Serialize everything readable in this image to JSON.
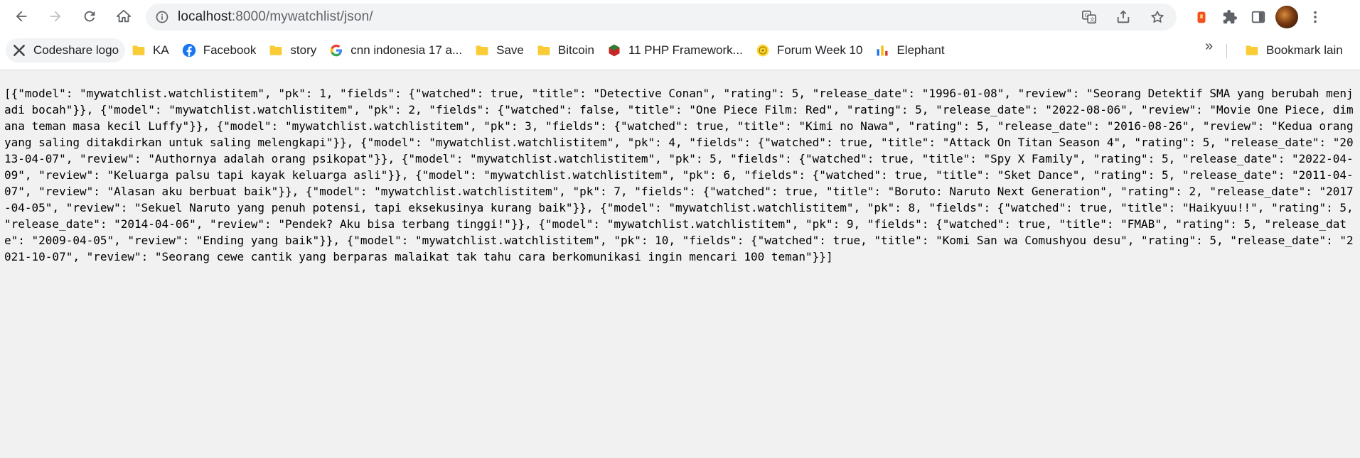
{
  "browser": {
    "url_prefix": "localhost",
    "url_rest": ":8000/mywatchlist/json/"
  },
  "bookmarks": [
    {
      "label": "Codeshare logo",
      "icon": "codeshare-icon"
    },
    {
      "label": "KA",
      "icon": "folder-icon"
    },
    {
      "label": "Facebook",
      "icon": "facebook-icon"
    },
    {
      "label": "story",
      "icon": "folder-icon"
    },
    {
      "label": "cnn indonesia 17 a...",
      "icon": "google-icon"
    },
    {
      "label": "Save",
      "icon": "folder-icon"
    },
    {
      "label": "Bitcoin",
      "icon": "folder-icon"
    },
    {
      "label": "11 PHP Framework...",
      "icon": "site-icon"
    },
    {
      "label": "Forum Week 10",
      "icon": "forum-icon"
    },
    {
      "label": "Elephant",
      "icon": "chart-icon"
    }
  ],
  "bookmarks_more": "»",
  "bookmarks_other": "Bookmark lain",
  "page": {
    "json_text": "[{\"model\": \"mywatchlist.watchlistitem\", \"pk\": 1, \"fields\": {\"watched\": true, \"title\": \"Detective Conan\", \"rating\": 5, \"release_date\": \"1996-01-08\", \"review\": \"Seorang Detektif SMA yang berubah menjadi bocah\"}}, {\"model\": \"mywatchlist.watchlistitem\", \"pk\": 2, \"fields\": {\"watched\": false, \"title\": \"One Piece Film: Red\", \"rating\": 5, \"release_date\": \"2022-08-06\", \"review\": \"Movie One Piece, dimana teman masa kecil Luffy\"}}, {\"model\": \"mywatchlist.watchlistitem\", \"pk\": 3, \"fields\": {\"watched\": true, \"title\": \"Kimi no Nawa\", \"rating\": 5, \"release_date\": \"2016-08-26\", \"review\": \"Kedua orang yang saling ditakdirkan untuk saling melengkapi\"}}, {\"model\": \"mywatchlist.watchlistitem\", \"pk\": 4, \"fields\": {\"watched\": true, \"title\": \"Attack On Titan Season 4\", \"rating\": 5, \"release_date\": \"2013-04-07\", \"review\": \"Authornya adalah orang psikopat\"}}, {\"model\": \"mywatchlist.watchlistitem\", \"pk\": 5, \"fields\": {\"watched\": true, \"title\": \"Spy X Family\", \"rating\": 5, \"release_date\": \"2022-04-09\", \"review\": \"Keluarga palsu tapi kayak keluarga asli\"}}, {\"model\": \"mywatchlist.watchlistitem\", \"pk\": 6, \"fields\": {\"watched\": true, \"title\": \"Sket Dance\", \"rating\": 5, \"release_date\": \"2011-04-07\", \"review\": \"Alasan aku berbuat baik\"}}, {\"model\": \"mywatchlist.watchlistitem\", \"pk\": 7, \"fields\": {\"watched\": true, \"title\": \"Boruto: Naruto Next Generation\", \"rating\": 2, \"release_date\": \"2017-04-05\", \"review\": \"Sekuel Naruto yang penuh potensi, tapi eksekusinya kurang baik\"}}, {\"model\": \"mywatchlist.watchlistitem\", \"pk\": 8, \"fields\": {\"watched\": true, \"title\": \"Haikyuu!!\", \"rating\": 5, \"release_date\": \"2014-04-06\", \"review\": \"Pendek? Aku bisa terbang tinggi!\"}}, {\"model\": \"mywatchlist.watchlistitem\", \"pk\": 9, \"fields\": {\"watched\": true, \"title\": \"FMAB\", \"rating\": 5, \"release_date\": \"2009-04-05\", \"review\": \"Ending yang baik\"}}, {\"model\": \"mywatchlist.watchlistitem\", \"pk\": 10, \"fields\": {\"watched\": true, \"title\": \"Komi San wa Comushyou desu\", \"rating\": 5, \"release_date\": \"2021-10-07\", \"review\": \"Seorang cewe cantik yang berparas malaikat tak tahu cara berkomunikasi ingin mencari 100 teman\"}}]"
  }
}
